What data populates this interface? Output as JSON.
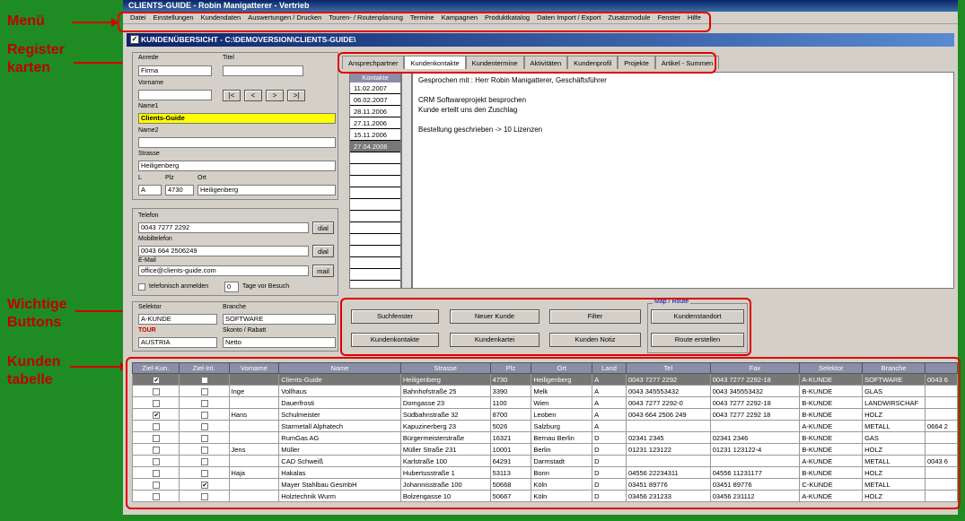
{
  "annotations": {
    "menu": "Menü",
    "register": "Register\nkarten",
    "buttons": "Wichtige\nButtons",
    "table": "Kunden\ntabelle"
  },
  "app": {
    "title": "CLIENTS-GUIDE - Robin Manigatterer - Vertrieb",
    "menu": [
      "Datei",
      "Einstellungen",
      "Kundendaten",
      "Auswertungen / Drucken",
      "Touren- / Routenplanung",
      "Termine",
      "Kampagnen",
      "Produktkatalog",
      "Daten Import / Export",
      "Zusatzmodule",
      "Fenster",
      "Hilfe"
    ],
    "window_title": "KUNDENÜBERSICHT - C:\\DEMOVERSION\\CLIENTS-GUIDE\\"
  },
  "address": {
    "anrede_label": "Anrede",
    "anrede": "Firma",
    "titel_label": "Titel",
    "titel": "",
    "vorname_label": "Vorname",
    "vorname": "",
    "nav": [
      "|<",
      "<",
      ">",
      ">|"
    ],
    "name1_label": "Name1",
    "name1": "Clients-Guide",
    "name2_label": "Name2",
    "name2": "",
    "strasse_label": "Strasse",
    "strasse": "Heiligenberg",
    "l_label": "L",
    "l": "A",
    "plz_label": "Plz",
    "plz": "4730",
    "ort_label": "Ort",
    "ort": "Heiligenberg"
  },
  "contact": {
    "telefon_label": "Telefon",
    "telefon": "0043 7277 2292",
    "mobil_label": "Mobiltelefon",
    "mobil": "0043 664 2506249",
    "email_label": "E-Mail",
    "email": "office@clients-guide.com",
    "dial": "dial",
    "mail": "mail",
    "anmelden": "telefonisch anmelden",
    "tage": "0",
    "tage_label": "Tage vor Besuch"
  },
  "selector": {
    "selektor_label": "Selektor",
    "selektor": "A-KUNDE",
    "branche_label": "Branche",
    "branche": "SOFTWARE",
    "tour_label": "TOUR",
    "tour": "AUSTRIA",
    "skonto_label": "Skonto / Rabatt",
    "skonto": "Netto"
  },
  "tabs": [
    "Ansprechpartner",
    "Kundenkontakte",
    "Kundentermine",
    "Aktivitäten",
    "Kundenprofil",
    "Projekte",
    "Artikel - Summen"
  ],
  "kontakte": {
    "header": "Kontakte",
    "dates": [
      "11.02.2007",
      "06.02.2007",
      "28.11.2006",
      "27.11.2006",
      "15.11.2006",
      "27.04.2006"
    ]
  },
  "notes": [
    "Gesprochen mit :  Herr  Robin Manigatterer, Geschäftsführer",
    "",
    "CRM Softwareprojekt besprochen",
    "Kunde erteilt uns den Zuschlag",
    "",
    "Bestellung geschrieben -> 10 Lizenzen"
  ],
  "buttons": {
    "suchfenster": "Suchfenster",
    "neuer_kunde": "Neuer Kunde",
    "filter": "Filter",
    "kundenkontakte": "Kundenkontakte",
    "kundenkartei": "Kundenkartei",
    "kunden_notiz": "Kunden Notiz",
    "map_label": "Map / Route",
    "kundenstandort": "Kundenstandort",
    "route": "Route erstellen"
  },
  "table": {
    "columns": [
      "Ziel-Kun.",
      "Ziel-Int.",
      "Vorname",
      "Name",
      "Strasse",
      "Plz",
      "Ort",
      "Land",
      "Tel",
      "Fax",
      "Selektor",
      "Branche",
      ""
    ],
    "rows": [
      {
        "zk": true,
        "zi": false,
        "vorname": "",
        "name": "Clients-Guide",
        "strasse": "Heiligenberg",
        "plz": "4730",
        "ort": "Heiligenberg",
        "land": "A",
        "tel": "0043 7277 2292",
        "fax": "0043 7277 2292-18",
        "sel": "A-KUNDE",
        "branche": "SOFTWARE",
        "extra": "0043 6"
      },
      {
        "zk": false,
        "zi": false,
        "vorname": "Inge",
        "name": "Vollhaus",
        "strasse": "Bahnhofstraße 25",
        "plz": "3390",
        "ort": "Melk",
        "land": "A",
        "tel": "0043 345553432",
        "fax": "0043 345553432",
        "sel": "B-KUNDE",
        "branche": "GLAS",
        "extra": ""
      },
      {
        "zk": false,
        "zi": false,
        "vorname": "",
        "name": "Dauerfrosti",
        "strasse": "Domgasse 23",
        "plz": "1100",
        "ort": "Wien",
        "land": "A",
        "tel": "0043 7277 2292-0",
        "fax": "0043 7277 2292-18",
        "sel": "B-KUNDE",
        "branche": "LANDWIRSCHAF",
        "extra": ""
      },
      {
        "zk": true,
        "zi": false,
        "vorname": "Hans",
        "name": "Schulmeister",
        "strasse": "Südbahnstraße 32",
        "plz": "8700",
        "ort": "Leoben",
        "land": "A",
        "tel": "0043 664 2506 249",
        "fax": "0043 7277 2292 18",
        "sel": "B-KUNDE",
        "branche": "HOLZ",
        "extra": ""
      },
      {
        "zk": false,
        "zi": false,
        "vorname": "",
        "name": "Starmetall Alphatech",
        "strasse": "Kapuzinerberg 23",
        "plz": "5026",
        "ort": "Salzburg",
        "land": "A",
        "tel": "",
        "fax": "",
        "sel": "A-KUNDE",
        "branche": "METALL",
        "extra": "0664 2"
      },
      {
        "zk": false,
        "zi": false,
        "vorname": "",
        "name": "RumGas AG",
        "strasse": "Bürgermeisterstraße",
        "plz": "16321",
        "ort": "Bernau Berlin",
        "land": "D",
        "tel": "02341 2345",
        "fax": "02341 2346",
        "sel": "B-KUNDE",
        "branche": "GAS",
        "extra": ""
      },
      {
        "zk": false,
        "zi": false,
        "vorname": "Jens",
        "name": "Müller",
        "strasse": "Müller Straße 231",
        "plz": "10001",
        "ort": "Berlin",
        "land": "D",
        "tel": "01231 123122",
        "fax": "01231 123122-4",
        "sel": "B-KUNDE",
        "branche": "HOLZ",
        "extra": ""
      },
      {
        "zk": false,
        "zi": false,
        "vorname": "",
        "name": "CAD Schweiß",
        "strasse": "Karlstraße 100",
        "plz": "64291",
        "ort": "Darmstadt",
        "land": "D",
        "tel": "",
        "fax": "",
        "sel": "A-KUNDE",
        "branche": "METALL",
        "extra": "0043 6"
      },
      {
        "zk": false,
        "zi": false,
        "vorname": "Haja",
        "name": "Hakalas",
        "strasse": "Hubertusstraße 1",
        "plz": "53113",
        "ort": "Bonn",
        "land": "D",
        "tel": "04556 22234311",
        "fax": "04556 11231177",
        "sel": "B-KUNDE",
        "branche": "HOLZ",
        "extra": ""
      },
      {
        "zk": false,
        "zi": true,
        "vorname": "",
        "name": "Mayer Stahlbau GesmbH",
        "strasse": "Johannisstraße 100",
        "plz": "50668",
        "ort": "Köln",
        "land": "D",
        "tel": "03451 89776",
        "fax": "03451 89776",
        "sel": "C-KUNDE",
        "branche": "METALL",
        "extra": ""
      },
      {
        "zk": false,
        "zi": false,
        "vorname": "",
        "name": "Holztechnik Wurm",
        "strasse": "Bolzengasse 10",
        "plz": "50667",
        "ort": "Köln",
        "land": "D",
        "tel": "03456 231233",
        "fax": "03456 231112",
        "sel": "A-KUNDE",
        "branche": "HOLZ",
        "extra": ""
      }
    ]
  }
}
